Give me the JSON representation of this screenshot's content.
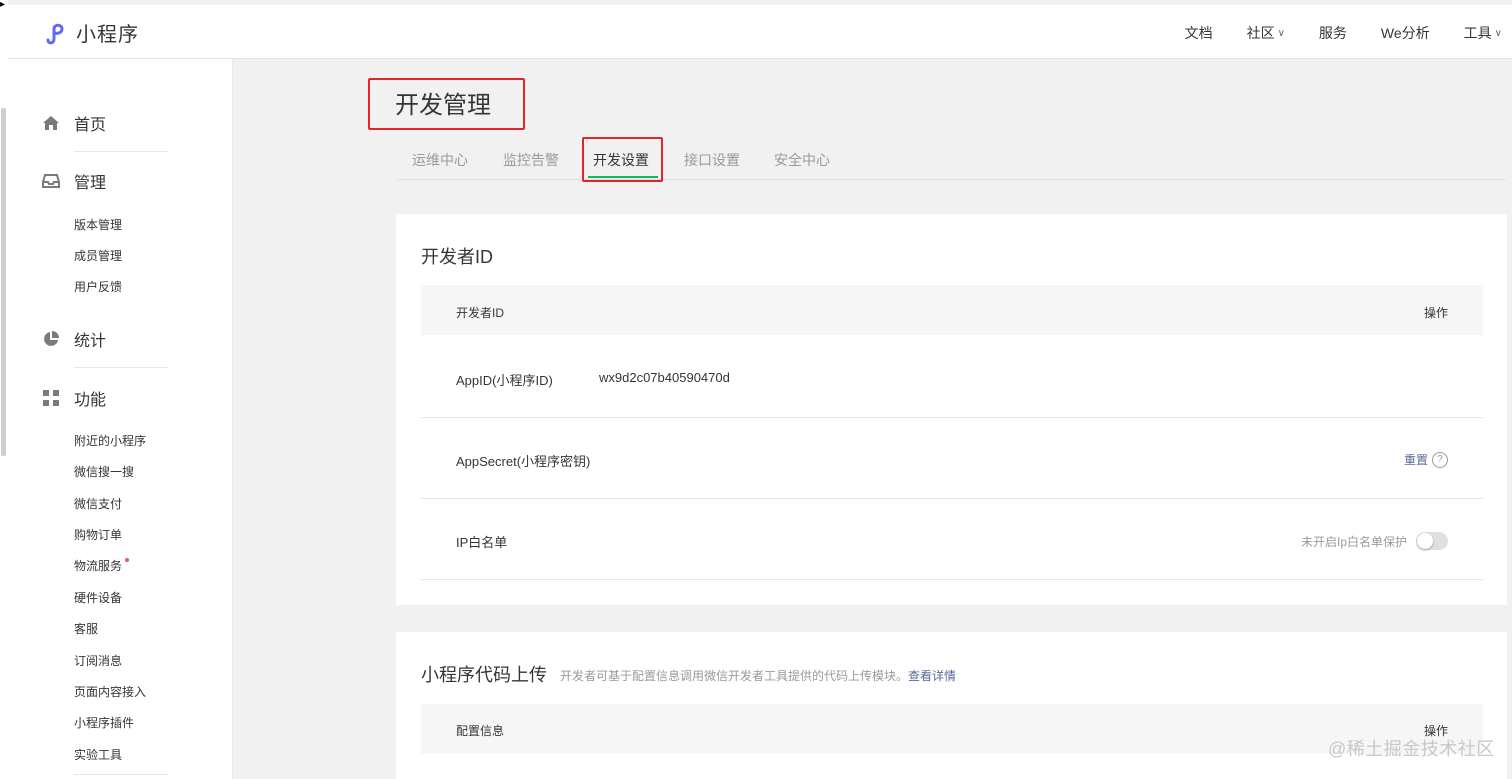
{
  "header": {
    "logo_text": "小程序",
    "nav": {
      "docs": "文档",
      "community": "社区",
      "services": "服务",
      "analytics": "We分析",
      "tools": "工具"
    }
  },
  "sidebar": {
    "home": "首页",
    "manage": "管理",
    "manage_items": [
      "版本管理",
      "成员管理",
      "用户反馈"
    ],
    "stats": "统计",
    "features": "功能",
    "feature_items": [
      "附近的小程序",
      "微信搜一搜",
      "微信支付",
      "购物订单",
      "物流服务",
      "硬件设备",
      "客服",
      "订阅消息",
      "页面内容接入",
      "小程序插件",
      "实验工具"
    ]
  },
  "page": {
    "title": "开发管理",
    "tabs": [
      "运维中心",
      "监控告警",
      "开发设置",
      "接口设置",
      "安全中心"
    ],
    "active_tab": "开发设置"
  },
  "developer_id": {
    "title": "开发者ID",
    "col_id": "开发者ID",
    "col_action": "操作",
    "appid_label": "AppID(小程序ID)",
    "appid_value": "wx9d2c07b40590470d",
    "appsecret_label": "AppSecret(小程序密钥)",
    "reset_label": "重置",
    "help_glyph": "?",
    "ip_label": "IP白名单",
    "ip_status": "未开启Ip白名单保护",
    "ip_enabled": false
  },
  "code_upload": {
    "title": "小程序代码上传",
    "desc": "开发者可基于配置信息调用微信开发者工具提供的代码上传模块。",
    "link": "查看详情",
    "col_config": "配置信息",
    "col_action": "操作"
  },
  "watermark": "@稀土掘金技术社区",
  "colors": {
    "accent_green": "#07c160",
    "link_blue": "#576b95",
    "highlight_red": "#e0242b",
    "logo_purple": "#6467f0"
  }
}
